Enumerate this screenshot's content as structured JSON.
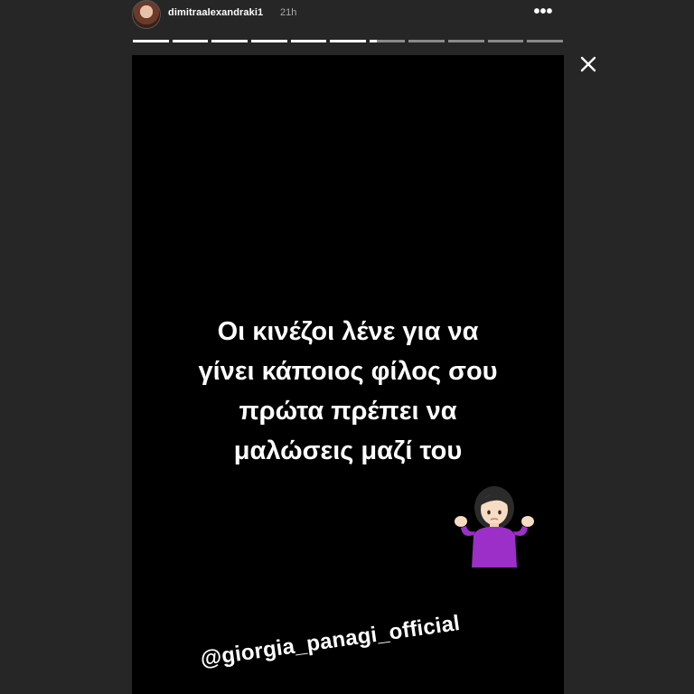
{
  "header": {
    "username": "dimitraalexandraki1",
    "time": "21h",
    "more_label": "•••"
  },
  "progress": {
    "segment_count": 11,
    "completed_segments": 6,
    "current_fraction": 0.2
  },
  "story": {
    "caption_lines": [
      "Οι κινέζοι λένε για να",
      "γίνει κάποιος φίλος σου",
      "πρώτα πρέπει να",
      "μαλώσεις μαζί του"
    ],
    "emoji_name": "person-shrugging-emoji",
    "mention": "@giorgia_panagi_official"
  },
  "colors": {
    "background": "#262626",
    "story_background": "#000000",
    "text": "#ffffff",
    "emoji_shirt": "#9b2fc8"
  }
}
